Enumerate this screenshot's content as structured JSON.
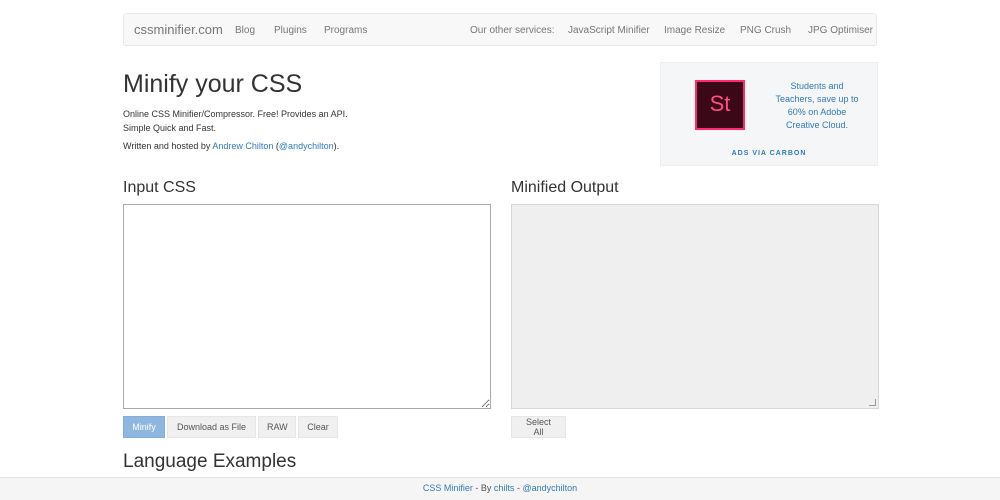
{
  "navbar": {
    "brand": "cssminifier.com",
    "left_links": [
      "Blog",
      "Plugins",
      "Programs"
    ],
    "services_label": "Our other services:",
    "right_links": [
      "JavaScript Minifier",
      "Image Resize",
      "PNG Crush",
      "JPG Optimiser"
    ]
  },
  "header": {
    "title": "Minify your CSS",
    "desc_line1": "Online CSS Minifier/Compressor. Free! Provides an API.",
    "desc_line2": "Simple Quick and Fast.",
    "byline_prefix": "Written and hosted by ",
    "author": "Andrew Chilton",
    "byline_open": " (",
    "handle": "@andychilton",
    "byline_close": ")."
  },
  "ad": {
    "logo_text": "St",
    "text": "Students and Teachers, save up to 60% on Adobe Creative Cloud.",
    "via": "ADS VIA CARBON"
  },
  "input": {
    "heading": "Input CSS",
    "value": ""
  },
  "output": {
    "heading": "Minified Output",
    "value": ""
  },
  "buttons": {
    "minify": "Minify",
    "download": "Download as File",
    "raw": "RAW",
    "clear": "Clear",
    "select_all": "Select All"
  },
  "language_heading": "Language Examples",
  "footer": {
    "site": "CSS Minifier",
    "by": " - By ",
    "author": "chilts",
    "sep": " - ",
    "handle": "@andychilton"
  },
  "colors": {
    "link": "#337ab7",
    "primary_button": "#8eb6de",
    "ad_logo_bg": "#3b0818",
    "ad_logo_accent": "#ff2a6d"
  }
}
